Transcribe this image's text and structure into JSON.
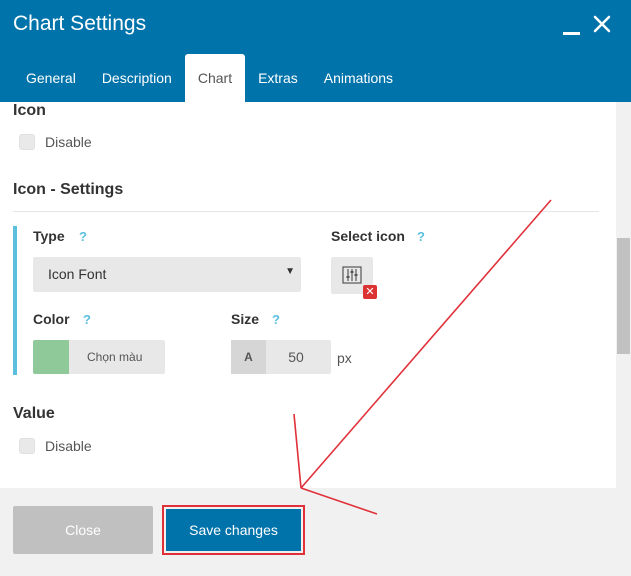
{
  "dialog": {
    "title": "Chart Settings"
  },
  "tabs": [
    {
      "label": "General"
    },
    {
      "label": "Description"
    },
    {
      "label": "Chart",
      "active": true
    },
    {
      "label": "Extras"
    },
    {
      "label": "Animations"
    }
  ],
  "icon_section": {
    "heading": "Icon",
    "disable_label": "Disable"
  },
  "icon_settings": {
    "heading": "Icon - Settings",
    "type_label": "Type",
    "type_value": "Icon Font",
    "select_icon_label": "Select icon",
    "color_label": "Color",
    "color_button": "Chọn màu",
    "color_value": "#8fc99a",
    "size_label": "Size",
    "size_prefix": "A",
    "size_value": "50",
    "size_unit": "px",
    "help": "?"
  },
  "value_section": {
    "heading": "Value",
    "disable_label": "Disable"
  },
  "footer": {
    "close_label": "Close",
    "save_label": "Save changes"
  },
  "colors": {
    "header": "#0073aa",
    "accent": "#5bc0de",
    "annotation": "#e0313a"
  }
}
